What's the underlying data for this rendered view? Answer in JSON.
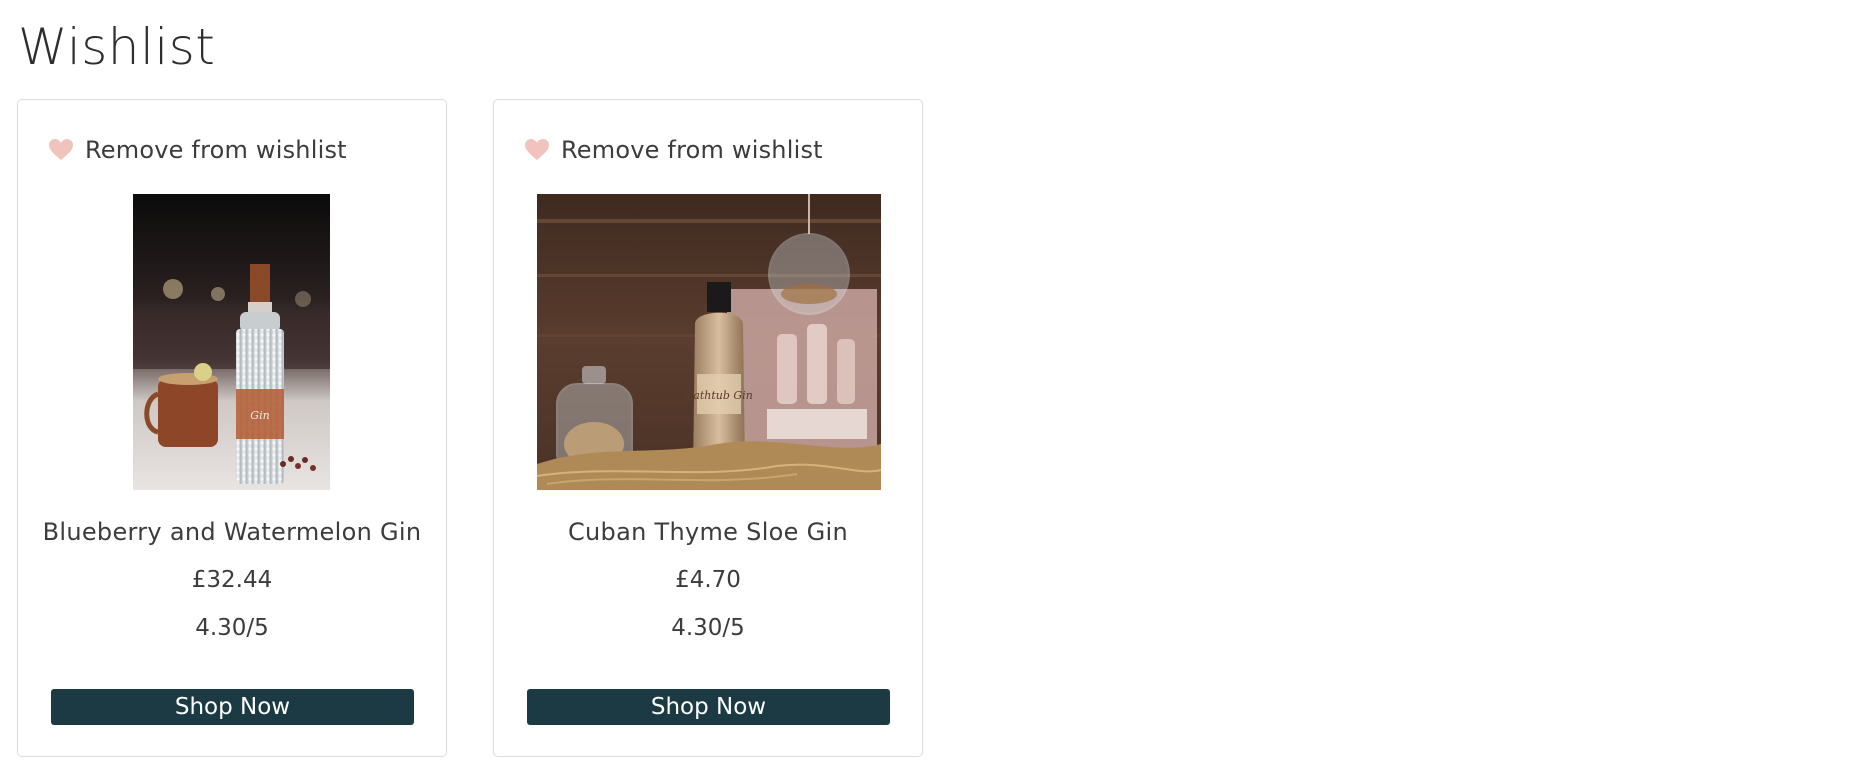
{
  "page": {
    "title": "Wishlist"
  },
  "colors": {
    "heart": "#f0c4bd",
    "button_bg": "#1c3a44",
    "button_text": "#ffffff",
    "card_border": "#dcdcdc"
  },
  "products": [
    {
      "wishlist_action": "Remove from wishlist",
      "heart_icon": "heart-icon",
      "image_alt": "Gin bottle with copper mug",
      "name": "Blueberry and Watermelon Gin",
      "price": "£32.44",
      "rating": "4.30/5",
      "button": "Shop Now"
    },
    {
      "wishlist_action": "Remove from wishlist",
      "heart_icon": "heart-icon",
      "image_alt": "Bathtub Gin bottle in gift crate",
      "name": "Cuban Thyme Sloe Gin",
      "price": "£4.70",
      "rating": "4.30/5",
      "button": "Shop Now"
    }
  ]
}
